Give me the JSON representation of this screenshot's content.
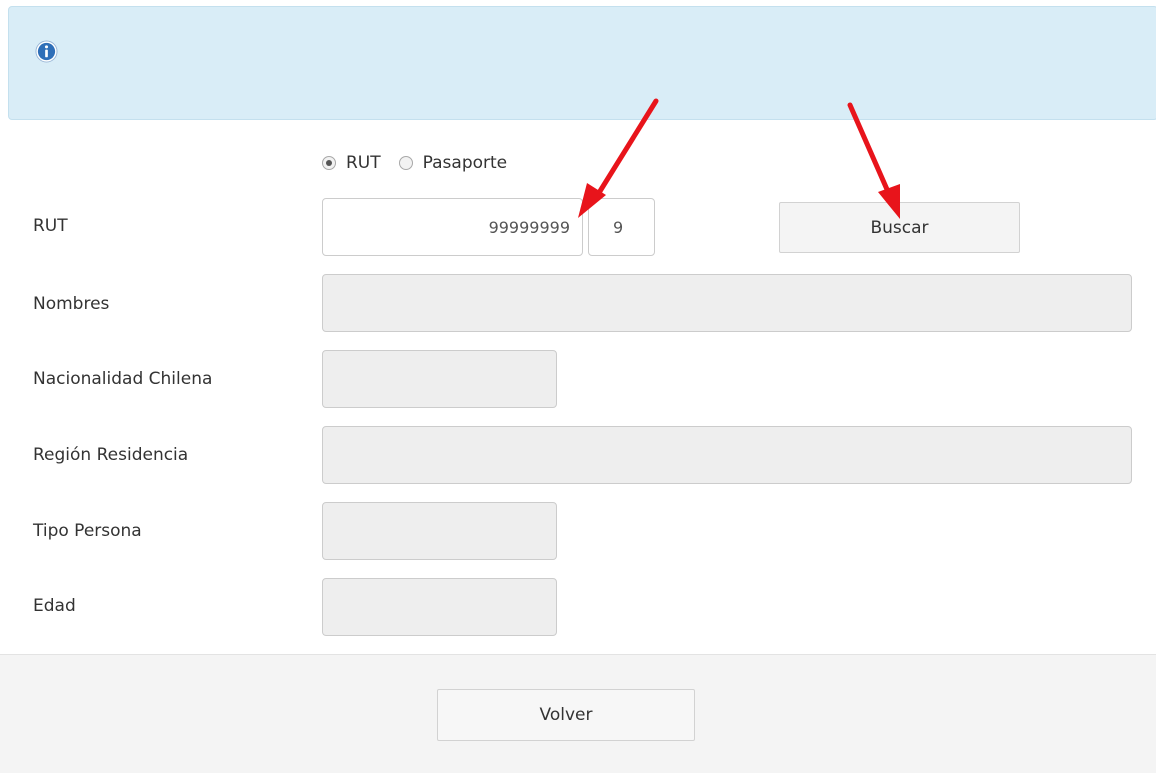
{
  "info_icon": "info-circle-icon",
  "search_type": {
    "options": [
      {
        "label": "RUT",
        "checked": true
      },
      {
        "label": "Pasaporte",
        "checked": false
      }
    ]
  },
  "form": {
    "rut_label": "RUT",
    "rut_number": "99999999",
    "rut_dv": "9",
    "search_button": "Buscar",
    "nombres_label": "Nombres",
    "nombres_value": "",
    "nacionalidad_label": "Nacionalidad Chilena",
    "nacionalidad_value": "",
    "region_label": "Región Residencia",
    "region_value": "",
    "tipo_persona_label": "Tipo Persona",
    "tipo_persona_value": "",
    "edad_label": "Edad",
    "edad_value": ""
  },
  "footer": {
    "back_button": "Volver"
  },
  "colors": {
    "info_background": "#d9edf7",
    "info_icon": "#2f6fb8",
    "annotation_arrow": "#e8141b"
  }
}
